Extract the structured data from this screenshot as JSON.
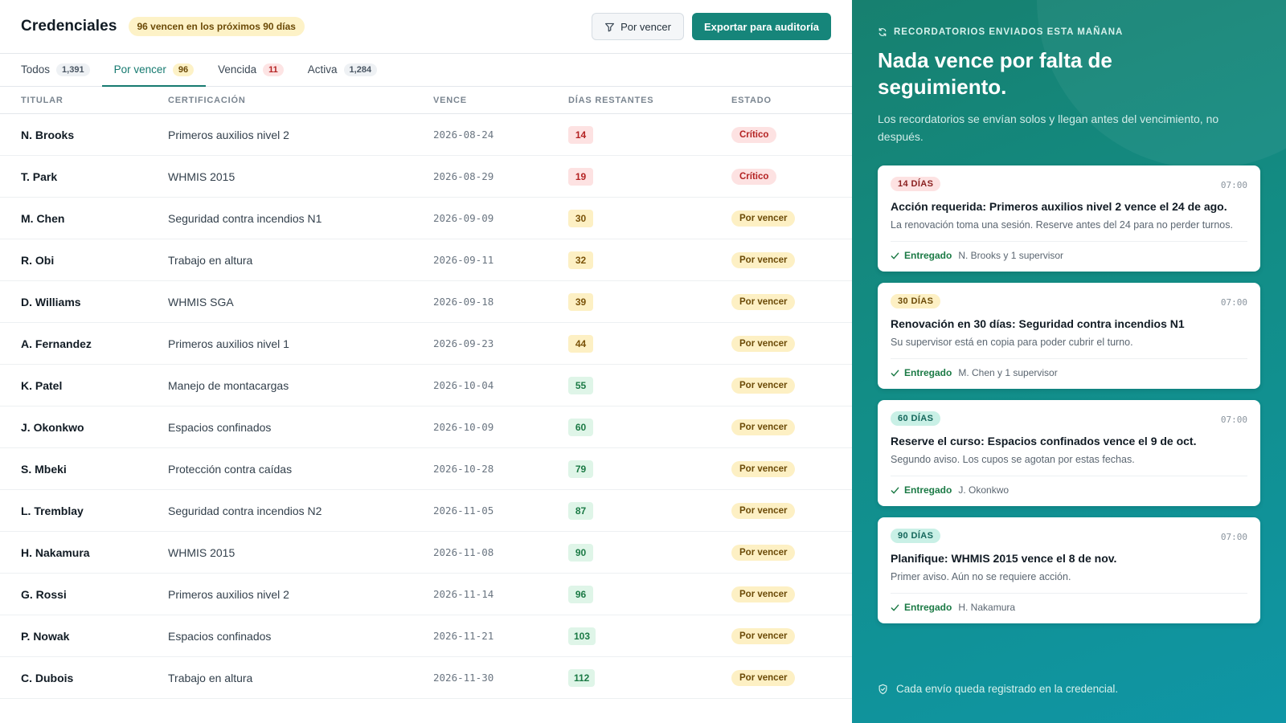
{
  "header": {
    "title": "Credenciales",
    "due_badge": "96 vencen en los próximos 90 días",
    "filter_label": "Por vencer",
    "export_label": "Exportar para auditoría"
  },
  "tabs": [
    {
      "label": "Todos",
      "count": "1,391"
    },
    {
      "label": "Por vencer",
      "count": "96"
    },
    {
      "label": "Vencida",
      "count": "11"
    },
    {
      "label": "Activa",
      "count": "1,284"
    }
  ],
  "table": {
    "columns": [
      "TITULAR",
      "CERTIFICACIÓN",
      "VENCE",
      "DÍAS RESTANTES",
      "ESTADO"
    ],
    "rows": [
      {
        "name": "N. Brooks",
        "cert": "Primeros auxilios nivel 2",
        "date": "2026-08-24",
        "days": "14",
        "status": "Crítico"
      },
      {
        "name": "T. Park",
        "cert": "WHMIS 2015",
        "date": "2026-08-29",
        "days": "19",
        "status": "Crítico"
      },
      {
        "name": "M. Chen",
        "cert": "Seguridad contra incendios N1",
        "date": "2026-09-09",
        "days": "30",
        "status": "Por vencer"
      },
      {
        "name": "R. Obi",
        "cert": "Trabajo en altura",
        "date": "2026-09-11",
        "days": "32",
        "status": "Por vencer"
      },
      {
        "name": "D. Williams",
        "cert": "WHMIS SGA",
        "date": "2026-09-18",
        "days": "39",
        "status": "Por vencer"
      },
      {
        "name": "A. Fernandez",
        "cert": "Primeros auxilios nivel 1",
        "date": "2026-09-23",
        "days": "44",
        "status": "Por vencer"
      },
      {
        "name": "K. Patel",
        "cert": "Manejo de montacargas",
        "date": "2026-10-04",
        "days": "55",
        "status": "Por vencer"
      },
      {
        "name": "J. Okonkwo",
        "cert": "Espacios confinados",
        "date": "2026-10-09",
        "days": "60",
        "status": "Por vencer"
      },
      {
        "name": "S. Mbeki",
        "cert": "Protección contra caídas",
        "date": "2026-10-28",
        "days": "79",
        "status": "Por vencer"
      },
      {
        "name": "L. Tremblay",
        "cert": "Seguridad contra incendios N2",
        "date": "2026-11-05",
        "days": "87",
        "status": "Por vencer"
      },
      {
        "name": "H. Nakamura",
        "cert": "WHMIS 2015",
        "date": "2026-11-08",
        "days": "90",
        "status": "Por vencer"
      },
      {
        "name": "G. Rossi",
        "cert": "Primeros auxilios nivel 2",
        "date": "2026-11-14",
        "days": "96",
        "status": "Por vencer"
      },
      {
        "name": "P. Nowak",
        "cert": "Espacios confinados",
        "date": "2026-11-21",
        "days": "103",
        "status": "Por vencer"
      },
      {
        "name": "C. Dubois",
        "cert": "Trabajo en altura",
        "date": "2026-11-30",
        "days": "112",
        "status": "Por vencer"
      }
    ]
  },
  "reminders": {
    "eyebrow": "RECORDATORIOS ENVIADOS ESTA MAÑANA",
    "headline": "Nada vence por falta de seguimiento.",
    "lede": "Los recordatorios se envían solos y llegan antes del vencimiento, no después.",
    "cards": [
      {
        "tag": "14 DÍAS",
        "time": "07:00",
        "title": "Acción requerida: Primeros auxilios nivel 2 vence el 24 de ago.",
        "body": "La renovación toma una sesión. Reserve antes del 24 para no perder turnos.",
        "delivered": "Entregado",
        "recipients": "N. Brooks y 1 supervisor"
      },
      {
        "tag": "30 DÍAS",
        "time": "07:00",
        "title": "Renovación en 30 días: Seguridad contra incendios N1",
        "body": "Su supervisor está en copia para poder cubrir el turno.",
        "delivered": "Entregado",
        "recipients": "M. Chen y 1 supervisor"
      },
      {
        "tag": "60 DÍAS",
        "time": "07:00",
        "title": "Reserve el curso: Espacios confinados vence el 9 de oct.",
        "body": "Segundo aviso. Los cupos se agotan por estas fechas.",
        "delivered": "Entregado",
        "recipients": "J. Okonkwo"
      },
      {
        "tag": "90 DÍAS",
        "time": "07:00",
        "title": "Planifique: WHMIS 2015 vence el 8 de nov.",
        "body": "Primer aviso. Aún no se requiere acción.",
        "delivered": "Entregado",
        "recipients": "H. Nakamura"
      }
    ],
    "footer": "Cada envío queda registrado en la credencial."
  }
}
